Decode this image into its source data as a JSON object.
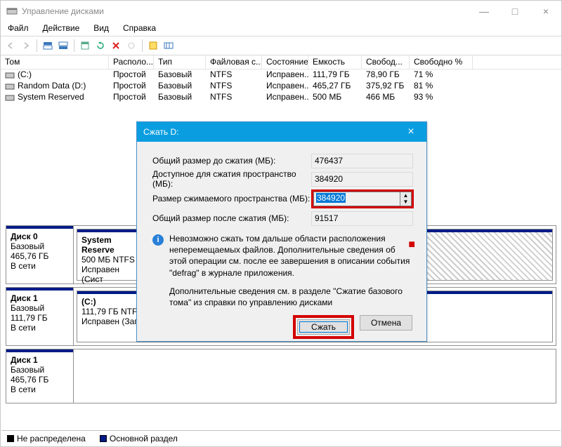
{
  "window": {
    "title": "Управление дисками",
    "minimize": "—",
    "maximize": "□",
    "close": "×"
  },
  "menu": [
    "Файл",
    "Действие",
    "Вид",
    "Справка"
  ],
  "columns": {
    "vol": "Том",
    "layout": "Располо...",
    "type": "Тип",
    "fs": "Файловая с...",
    "state": "Состояние",
    "cap": "Емкость",
    "free": "Свобод...",
    "pct": "Свободно %"
  },
  "volumes": [
    {
      "name": "(C:)",
      "layout": "Простой",
      "type": "Базовый",
      "fs": "NTFS",
      "state": "Исправен...",
      "cap": "111,79 ГБ",
      "free": "78,90 ГБ",
      "pct": "71 %"
    },
    {
      "name": "Random Data (D:)",
      "layout": "Простой",
      "type": "Базовый",
      "fs": "NTFS",
      "state": "Исправен...",
      "cap": "465,27 ГБ",
      "free": "375,92 ГБ",
      "pct": "81 %"
    },
    {
      "name": "System Reserved",
      "layout": "Простой",
      "type": "Базовый",
      "fs": "NTFS",
      "state": "Исправен...",
      "cap": "500 МБ",
      "free": "466 МБ",
      "pct": "93 %"
    }
  ],
  "disks": {
    "d0": {
      "title": "Диск 0",
      "kind": "Базовый",
      "size": "465,76 ГБ",
      "status": "В сети",
      "p1": {
        "name": "System Reserve",
        "info": "500 МБ NTFS",
        "state": "Исправен (Сист"
      }
    },
    "d1": {
      "title": "Диск 1",
      "kind": "Базовый",
      "size": "111,79 ГБ",
      "status": "В сети",
      "p1": {
        "name": "(C:)",
        "info": "111,79 ГБ NTFS",
        "state": "Исправен (Загрузка, Файл подкачки, Аварийный дамп памяти, Основной раздел)"
      }
    },
    "d2": {
      "title": "Диск 1",
      "kind": "Базовый",
      "size": "465,76 ГБ",
      "status": "В сети"
    }
  },
  "legend": {
    "unalloc": "Не распределена",
    "primary": "Основной раздел"
  },
  "dialog": {
    "title": "Сжать D:",
    "f1_label": "Общий размер до сжатия (МБ):",
    "f1_val": "476437",
    "f2_label": "Доступное для сжатия пространство (МБ):",
    "f2_val": "384920",
    "f3_label": "Размер сжимаемого пространства (МБ):",
    "f3_val": "384920",
    "f4_label": "Общий размер после сжатия (МБ):",
    "f4_val": "91517",
    "info1": "Невозможно сжать том дальше области расположения неперемещаемых файлов. Дополнительные сведения об этой операции см. после ее завершения в описании события \"defrag\" в журнале приложения.",
    "info2": "Дополнительные сведения см. в разделе \"Сжатие базового тома\" из справки по управлению дисками",
    "btn_ok": "Сжать",
    "btn_cancel": "Отмена",
    "close": "×"
  }
}
